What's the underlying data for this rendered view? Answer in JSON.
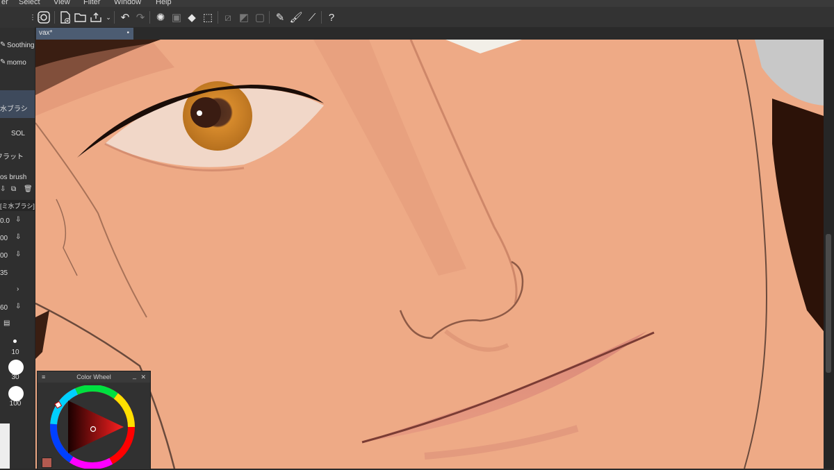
{
  "menu": [
    "er",
    "Select",
    "View",
    "Filter",
    "Window",
    "Help"
  ],
  "toolbar_icons": [
    "app-icon",
    "new-canvas-icon",
    "open-icon",
    "export-icon",
    "undo-icon",
    "redo-icon",
    "loading-icon",
    "select-all-icon",
    "fill-icon",
    "transform-icon",
    "deselect-icon",
    "invert-icon",
    "border-icon",
    "pen-icon",
    "brush-icon",
    "line-icon",
    "help-icon"
  ],
  "document_tab": {
    "label": "vax*",
    "modified": "•"
  },
  "left_panel": {
    "sub_tools": [
      "Soothing",
      "momo"
    ],
    "brush_names": [
      "水ブラシ",
      "SOL",
      "フラット"
    ],
    "brush_set_label": "os brush",
    "property_title": "[ミ水ブラシ]",
    "values": [
      "0.0",
      "00",
      "00",
      "35",
      "60"
    ],
    "brush_sizes": [
      "10",
      "30",
      "100"
    ]
  },
  "color_wheel": {
    "title": "Color Wheel",
    "current_color": "#b35a50"
  }
}
